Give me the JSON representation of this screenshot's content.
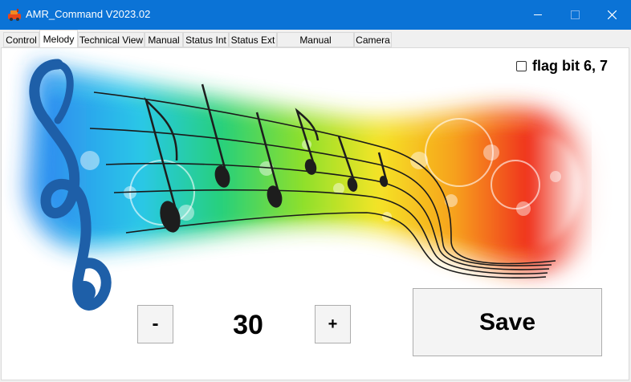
{
  "window": {
    "title": "AMR_Command V2023.02",
    "controls": {
      "minimize": "minimize-icon",
      "maximize": "maximize-icon",
      "close": "close-icon"
    }
  },
  "tabs": [
    {
      "label": "Control",
      "active": false
    },
    {
      "label": "Melody",
      "active": true
    },
    {
      "label": "Technical View",
      "active": false
    },
    {
      "label": "Manual",
      "active": false
    },
    {
      "label": "Status Int",
      "active": false
    },
    {
      "label": "Status Ext",
      "active": false
    },
    {
      "label": "Manual Command",
      "active": false
    },
    {
      "label": "Camera",
      "active": false
    }
  ],
  "melody": {
    "flag_label": "flag bit 6, 7",
    "flag_checked": false,
    "decrement_label": "-",
    "value": "30",
    "increment_label": "+",
    "save_label": "Save"
  },
  "colors": {
    "titlebar": "#0b73d6",
    "background": "#f0f0f0",
    "panel": "#ffffff"
  }
}
